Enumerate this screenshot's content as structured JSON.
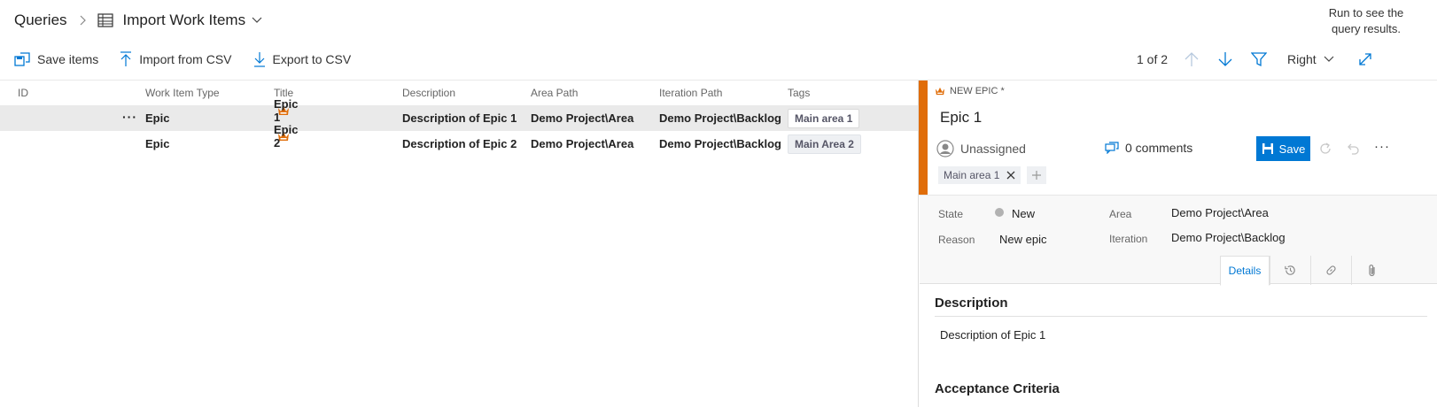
{
  "header": {
    "breadcrumb_root": "Queries",
    "page_title": "Import Work Items",
    "hint": "Run to see the query results."
  },
  "toolbar": {
    "save_items": "Save items",
    "import_csv": "Import from CSV",
    "export_csv": "Export to CSV"
  },
  "nav": {
    "pager": "1 of 2",
    "pane_position": "Right"
  },
  "grid": {
    "columns": {
      "id": "ID",
      "type": "Work Item Type",
      "title": "Title",
      "description": "Description",
      "area": "Area Path",
      "iteration": "Iteration Path",
      "tags": "Tags"
    },
    "rows": [
      {
        "type": "Epic",
        "title": "Epic 1",
        "description": "Description of Epic 1",
        "area": "Demo Project\\Area",
        "iteration": "Demo Project\\Backlog",
        "tags": "Main area 1"
      },
      {
        "type": "Epic",
        "title": "Epic 2",
        "description": "Description of Epic 2",
        "area": "Demo Project\\Area",
        "iteration": "Demo Project\\Backlog",
        "tags": "Main Area 2"
      }
    ],
    "more_label": "···"
  },
  "panel": {
    "type_label": "NEW EPIC *",
    "title": "Epic 1",
    "assignee": "Unassigned",
    "comments": "0 comments",
    "save_label": "Save",
    "more_label": "···",
    "tag": "Main area 1",
    "fields": {
      "state_label": "State",
      "state_value": "New",
      "reason_label": "Reason",
      "reason_value": "New epic",
      "area_label": "Area",
      "area_value": "Demo Project\\Area",
      "iteration_label": "Iteration",
      "iteration_value": "Demo Project\\Backlog"
    },
    "tabs": {
      "details": "Details"
    },
    "description_heading": "Description",
    "description_body": "Description of Epic 1",
    "acceptance_heading": "Acceptance Criteria"
  },
  "colors": {
    "accent": "#e06d09",
    "primary": "#0078d4",
    "icon_blue": "#0078d4",
    "state_new": "#b2b2b2"
  }
}
